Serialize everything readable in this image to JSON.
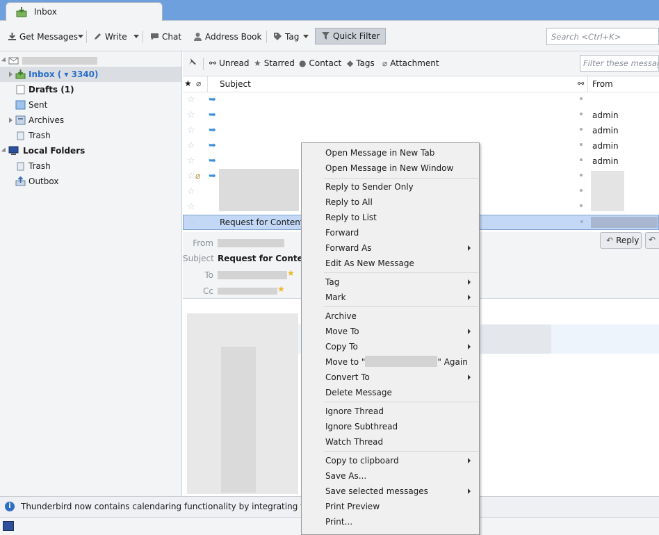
{
  "tab": {
    "title": "Inbox"
  },
  "toolbar": {
    "get_messages": "Get Messages",
    "write": "Write",
    "chat": "Chat",
    "address_book": "Address Book",
    "tag": "Tag",
    "quick_filter": "Quick Filter",
    "search_placeholder": "Search <Ctrl+K>"
  },
  "folders": {
    "inbox": "Inbox ( ▾ 3340)",
    "drafts": "Drafts (1)",
    "sent": "Sent",
    "archives": "Archives",
    "trash": "Trash",
    "local_folders": "Local Folders",
    "local_trash": "Trash",
    "outbox": "Outbox"
  },
  "quick_filter_bar": {
    "unread": "Unread",
    "starred": "Starred",
    "contact": "Contact",
    "tags": "Tags",
    "attachment": "Attachment",
    "filter_placeholder": "Filter these messages"
  },
  "columns": {
    "subject": "Subject",
    "from": "From"
  },
  "messages": [
    {
      "subject": "",
      "from": ""
    },
    {
      "subject": "",
      "from": "admin"
    },
    {
      "subject": "",
      "from": "admin"
    },
    {
      "subject": "",
      "from": "admin"
    },
    {
      "subject": "",
      "from": "admin"
    },
    {
      "subject": "",
      "from": ""
    },
    {
      "subject": "",
      "from": ""
    },
    {
      "subject": "",
      "from": ""
    },
    {
      "subject": "Request for Content",
      "from": ""
    }
  ],
  "header_pane": {
    "from_label": "From",
    "subject_label": "Subject",
    "subject_value": "Request for Content",
    "to_label": "To",
    "cc_label": "Cc",
    "reply": "Reply"
  },
  "notification": "Thunderbird now contains calendaring functionality by integrating the Light",
  "context_menu": {
    "open_new_tab": "Open Message in New Tab",
    "open_new_window": "Open Message in New Window",
    "reply_sender": "Reply to Sender Only",
    "reply_all": "Reply to All",
    "reply_list": "Reply to List",
    "forward": "Forward",
    "forward_as": "Forward As",
    "edit_new": "Edit As New Message",
    "tag": "Tag",
    "mark": "Mark",
    "archive": "Archive",
    "move_to": "Move To",
    "copy_to": "Copy To",
    "move_again_pre": "Move to \"",
    "move_again_post": "\" Again",
    "convert_to": "Convert To",
    "delete": "Delete Message",
    "ignore_thread": "Ignore Thread",
    "ignore_subthread": "Ignore Subthread",
    "watch_thread": "Watch Thread",
    "copy_clipboard": "Copy to clipboard",
    "save_as": "Save As...",
    "save_selected": "Save selected messages",
    "print_preview": "Print Preview",
    "print": "Print..."
  },
  "colors": {
    "tabbar": "#6fa0de",
    "selection": "#c2d8f6",
    "link": "#2a6fc9"
  }
}
